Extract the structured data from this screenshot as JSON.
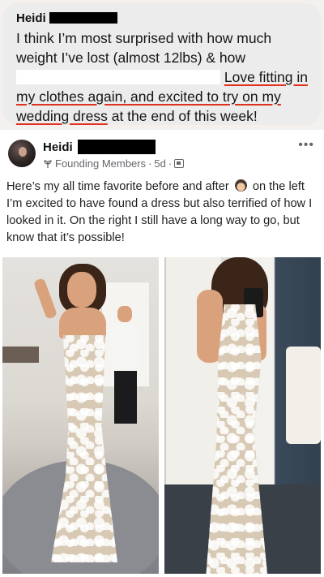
{
  "message": {
    "sender": "Heidi",
    "line1": "I think I’m most surprised with how much weight I’ve lost (almost 12lbs) & how",
    "line2_tail": "Love fitting in",
    "line3": "my clothes again, and excited to try on my",
    "line4_underlined": "wedding dress",
    "line4_tail": " at the end of this week!"
  },
  "post": {
    "author": "Heidi",
    "badge": "Founding Members",
    "separator": " · ",
    "time": "5d",
    "separator2": " · ",
    "more": "•••",
    "text_before_emoji": "Here’s my all time favorite before and after",
    "text_after_emoji": " on the left I’m excited to have found a dress but also terrified of how I looked in it. On the right I still have a long way to go, but know that it’s possible!"
  },
  "colors": {
    "bubble_bg": "#ececec",
    "spellcheck_underline": "#e0301e",
    "meta_text": "#65676b"
  },
  "icons": {
    "badge": "founding-member-badge-icon",
    "privacy": "group-privacy-icon",
    "more": "more-options-icon",
    "emoji": "woman-emoji-icon"
  }
}
